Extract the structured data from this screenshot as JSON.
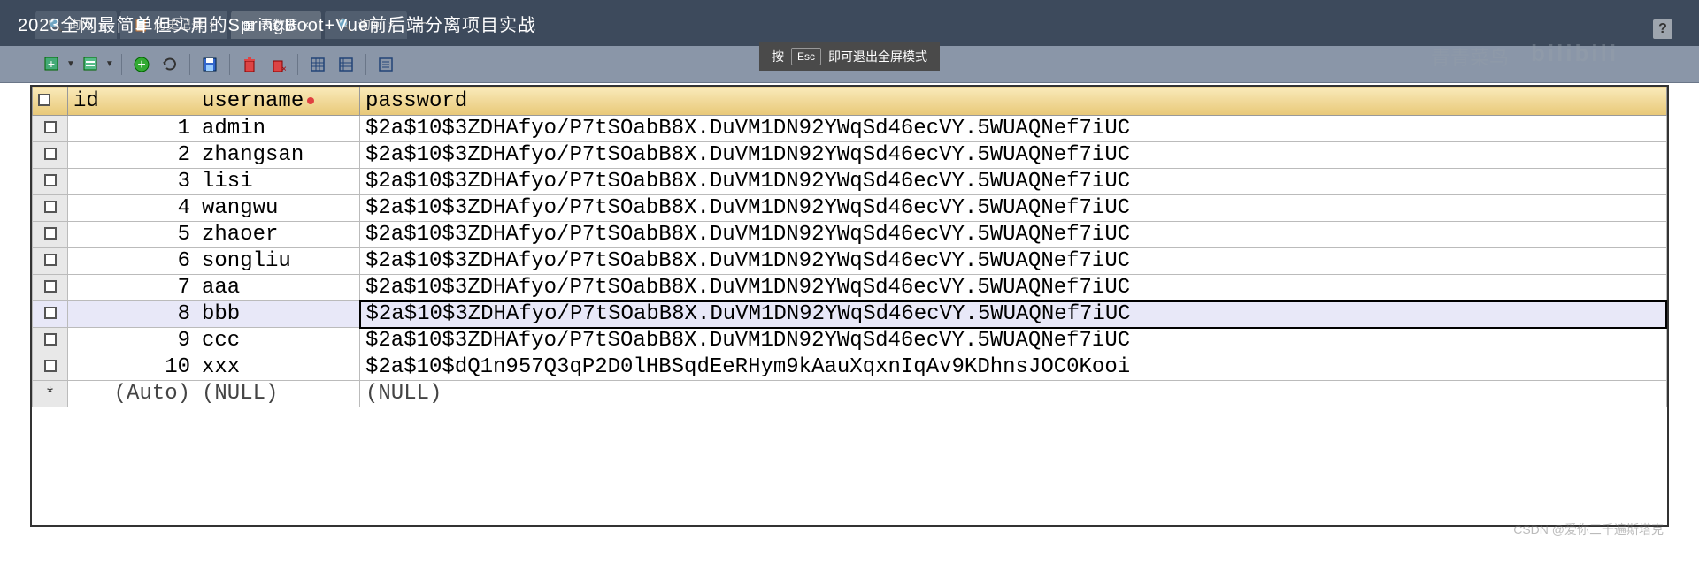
{
  "title": "2023全网最简单但实用的SpringBoot+Vue前后端分离项目实战",
  "tabs": [
    {
      "icon": "query",
      "label": "询问"
    },
    {
      "icon": "history",
      "label": "历史记录"
    },
    {
      "icon": "table",
      "label": "表数据"
    },
    {
      "icon": "query",
      "label": "询问"
    }
  ],
  "esc_hint": {
    "prefix": "按",
    "key": "Esc",
    "suffix": "即可退出全屏模式"
  },
  "watermark_user": "青青菜鸟",
  "watermark_site": "bilibili",
  "columns": [
    "id",
    "username",
    "password"
  ],
  "rows": [
    {
      "id": "1",
      "username": "admin",
      "password": "$2a$10$3ZDHAfyo/P7tSOabB8X.DuVM1DN92YWqSd46ecVY.5WUAQNef7iUC"
    },
    {
      "id": "2",
      "username": "zhangsan",
      "password": "$2a$10$3ZDHAfyo/P7tSOabB8X.DuVM1DN92YWqSd46ecVY.5WUAQNef7iUC"
    },
    {
      "id": "3",
      "username": "lisi",
      "password": "$2a$10$3ZDHAfyo/P7tSOabB8X.DuVM1DN92YWqSd46ecVY.5WUAQNef7iUC"
    },
    {
      "id": "4",
      "username": "wangwu",
      "password": "$2a$10$3ZDHAfyo/P7tSOabB8X.DuVM1DN92YWqSd46ecVY.5WUAQNef7iUC"
    },
    {
      "id": "5",
      "username": "zhaoer",
      "password": "$2a$10$3ZDHAfyo/P7tSOabB8X.DuVM1DN92YWqSd46ecVY.5WUAQNef7iUC"
    },
    {
      "id": "6",
      "username": "songliu",
      "password": "$2a$10$3ZDHAfyo/P7tSOabB8X.DuVM1DN92YWqSd46ecVY.5WUAQNef7iUC"
    },
    {
      "id": "7",
      "username": "aaa",
      "password": "$2a$10$3ZDHAfyo/P7tSOabB8X.DuVM1DN92YWqSd46ecVY.5WUAQNef7iUC"
    },
    {
      "id": "8",
      "username": "bbb",
      "password": "$2a$10$3ZDHAfyo/P7tSOabB8X.DuVM1DN92YWqSd46ecVY.5WUAQNef7iUC",
      "selected": true
    },
    {
      "id": "9",
      "username": "ccc",
      "password": "$2a$10$3ZDHAfyo/P7tSOabB8X.DuVM1DN92YWqSd46ecVY.5WUAQNef7iUC"
    },
    {
      "id": "10",
      "username": "xxx",
      "password": "$2a$10$dQ1n957Q3qP2D0lHBSqdEeRHym9kAauXqxnIqAv9KDhnsJOC0Kooi"
    }
  ],
  "auto_row": {
    "id": "(Auto)",
    "username": "(NULL)",
    "password": "(NULL)"
  },
  "footer_watermark": "CSDN @爱你三千遍斯塔克"
}
